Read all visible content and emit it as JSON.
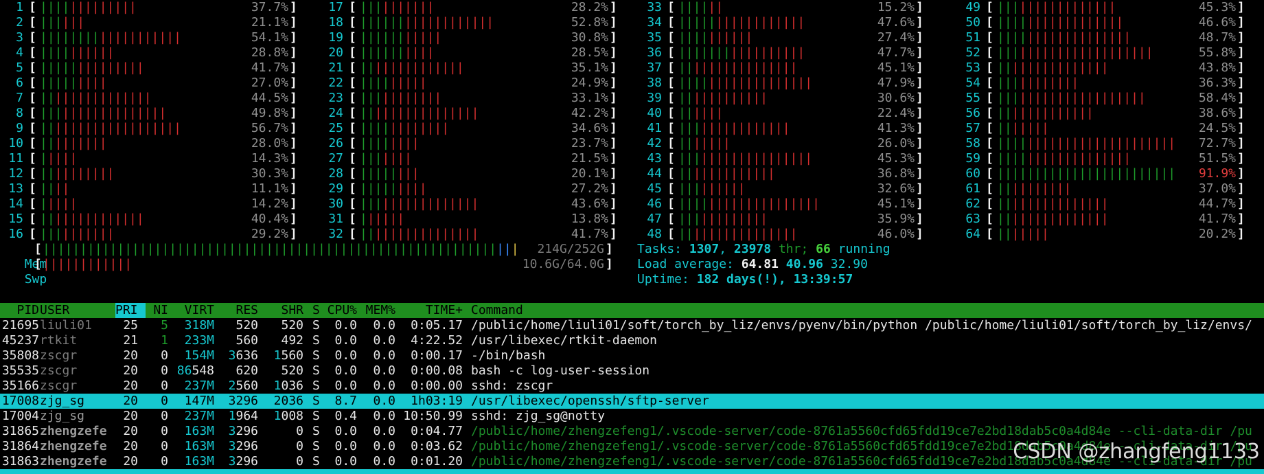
{
  "cpus": [
    {
      "n": "1",
      "g": 4,
      "r": 9,
      "pct": "37.7%"
    },
    {
      "n": "2",
      "g": 3,
      "r": 3,
      "pct": "21.1%"
    },
    {
      "n": "3",
      "g": 8,
      "r": 11,
      "pct": "54.1%"
    },
    {
      "n": "4",
      "g": 4,
      "r": 6,
      "pct": "28.8%"
    },
    {
      "n": "5",
      "g": 5,
      "r": 9,
      "pct": "41.7%"
    },
    {
      "n": "6",
      "g": 5,
      "r": 4,
      "pct": "27.0%"
    },
    {
      "n": "7",
      "g": 2,
      "r": 13,
      "pct": "44.5%"
    },
    {
      "n": "8",
      "g": 3,
      "r": 14,
      "pct": "49.8%"
    },
    {
      "n": "9",
      "g": 2,
      "r": 17,
      "pct": "56.7%"
    },
    {
      "n": "10",
      "g": 2,
      "r": 7,
      "pct": "28.0%"
    },
    {
      "n": "11",
      "g": 1,
      "r": 4,
      "pct": "14.3%"
    },
    {
      "n": "12",
      "g": 2,
      "r": 8,
      "pct": "30.3%"
    },
    {
      "n": "13",
      "g": 2,
      "r": 2,
      "pct": "11.1%"
    },
    {
      "n": "14",
      "g": 1,
      "r": 4,
      "pct": "14.2%"
    },
    {
      "n": "15",
      "g": 2,
      "r": 12,
      "pct": "40.4%"
    },
    {
      "n": "16",
      "g": 3,
      "r": 7,
      "pct": "29.2%"
    },
    {
      "n": "17",
      "g": 3,
      "r": 7,
      "pct": "28.2%"
    },
    {
      "n": "18",
      "g": 6,
      "r": 12,
      "pct": "52.8%"
    },
    {
      "n": "19",
      "g": 6,
      "r": 5,
      "pct": "30.8%"
    },
    {
      "n": "20",
      "g": 6,
      "r": 4,
      "pct": "28.5%"
    },
    {
      "n": "21",
      "g": 2,
      "r": 12,
      "pct": "35.1%"
    },
    {
      "n": "22",
      "g": 4,
      "r": 5,
      "pct": "24.9%"
    },
    {
      "n": "23",
      "g": 3,
      "r": 8,
      "pct": "33.1%"
    },
    {
      "n": "24",
      "g": 2,
      "r": 14,
      "pct": "42.2%"
    },
    {
      "n": "25",
      "g": 4,
      "r": 8,
      "pct": "34.6%"
    },
    {
      "n": "26",
      "g": 4,
      "r": 4,
      "pct": "23.7%"
    },
    {
      "n": "27",
      "g": 3,
      "r": 4,
      "pct": "21.5%"
    },
    {
      "n": "28",
      "g": 5,
      "r": 3,
      "pct": "20.1%"
    },
    {
      "n": "29",
      "g": 5,
      "r": 4,
      "pct": "27.2%"
    },
    {
      "n": "30",
      "g": 3,
      "r": 13,
      "pct": "43.6%"
    },
    {
      "n": "31",
      "g": 1,
      "r": 5,
      "pct": "13.8%"
    },
    {
      "n": "32",
      "g": 2,
      "r": 14,
      "pct": "41.7%"
    },
    {
      "n": "33",
      "g": 4,
      "r": 2,
      "pct": "15.2%"
    },
    {
      "n": "34",
      "g": 5,
      "r": 12,
      "pct": "47.6%"
    },
    {
      "n": "35",
      "g": 4,
      "r": 6,
      "pct": "27.4%"
    },
    {
      "n": "36",
      "g": 7,
      "r": 10,
      "pct": "47.7%"
    },
    {
      "n": "37",
      "g": 2,
      "r": 14,
      "pct": "45.1%"
    },
    {
      "n": "38",
      "g": 4,
      "r": 14,
      "pct": "47.9%"
    },
    {
      "n": "39",
      "g": 2,
      "r": 10,
      "pct": "30.6%"
    },
    {
      "n": "40",
      "g": 2,
      "r": 4,
      "pct": "22.4%"
    },
    {
      "n": "41",
      "g": 3,
      "r": 12,
      "pct": "41.3%"
    },
    {
      "n": "42",
      "g": 2,
      "r": 5,
      "pct": "26.0%"
    },
    {
      "n": "43",
      "g": 3,
      "r": 15,
      "pct": "45.3%"
    },
    {
      "n": "44",
      "g": 2,
      "r": 11,
      "pct": "36.8%"
    },
    {
      "n": "45",
      "g": 3,
      "r": 6,
      "pct": "32.6%"
    },
    {
      "n": "46",
      "g": 4,
      "r": 15,
      "pct": "45.1%"
    },
    {
      "n": "47",
      "g": 3,
      "r": 9,
      "pct": "35.9%"
    },
    {
      "n": "48",
      "g": 2,
      "r": 14,
      "pct": "46.0%"
    },
    {
      "n": "49",
      "g": 3,
      "r": 13,
      "pct": "45.3%"
    },
    {
      "n": "50",
      "g": 4,
      "r": 13,
      "pct": "46.6%"
    },
    {
      "n": "51",
      "g": 4,
      "r": 14,
      "pct": "48.7%"
    },
    {
      "n": "52",
      "g": 3,
      "r": 18,
      "pct": "55.8%"
    },
    {
      "n": "53",
      "g": 2,
      "r": 13,
      "pct": "43.8%"
    },
    {
      "n": "54",
      "g": 3,
      "r": 8,
      "pct": "36.3%"
    },
    {
      "n": "55",
      "g": 3,
      "r": 17,
      "pct": "58.4%"
    },
    {
      "n": "56",
      "g": 2,
      "r": 11,
      "pct": "38.6%"
    },
    {
      "n": "57",
      "g": 2,
      "r": 5,
      "pct": "24.5%"
    },
    {
      "n": "58",
      "g": 4,
      "r": 21,
      "pct": "72.7%"
    },
    {
      "n": "59",
      "g": 4,
      "r": 14,
      "pct": "51.5%"
    },
    {
      "n": "60",
      "g": 30,
      "r": 0,
      "pct": "91.9%",
      "hot": true
    },
    {
      "n": "61",
      "g": 2,
      "r": 8,
      "pct": "37.0%"
    },
    {
      "n": "62",
      "g": 2,
      "r": 13,
      "pct": "44.7%"
    },
    {
      "n": "63",
      "g": 2,
      "r": 13,
      "pct": "41.7%"
    },
    {
      "n": "64",
      "g": 2,
      "r": 5,
      "pct": "20.2%"
    }
  ],
  "mem": {
    "label": "Mem",
    "used_fraction": 0.85,
    "value": "214G/252G"
  },
  "swp": {
    "label": "Swp",
    "used_fraction": 0.17,
    "value": "10.6G/64.0G"
  },
  "tasks": {
    "label": "Tasks:",
    "count": "1307",
    "sep": ",",
    "thr": "23978",
    "thr_label": "thr;",
    "running": "66",
    "running_label": "running"
  },
  "load": {
    "label": "Load average:",
    "l1": "64.81",
    "l5": "40.96",
    "l15": "32.90"
  },
  "uptime": {
    "label": "Uptime:",
    "value": "182 days(!), 13:39:57"
  },
  "columns": [
    "PID",
    "USER",
    "PRI",
    "NI",
    "VIRT",
    "RES",
    "SHR",
    "S",
    "CPU%",
    "MEM%",
    "TIME+",
    "Command"
  ],
  "processes": [
    {
      "pid": "21695",
      "user": "liuli01",
      "pri": "25",
      "ni": "5",
      "virt": "318M",
      "res": "520",
      "shr": "520",
      "s": "S",
      "cpu": "0.0",
      "mem": "0.0",
      "time": "0:05.17",
      "cmd": "/public/home/liuli01/soft/torch_by_liz/envs/pyenv/bin/python /public/home/liuli01/soft/torch_by_liz/envs/"
    },
    {
      "pid": "45237",
      "user": "rtkit",
      "pri": "21",
      "ni": "1",
      "virt": "233M",
      "res": "560",
      "shr": "492",
      "s": "S",
      "cpu": "0.0",
      "mem": "0.0",
      "time": "4:22.52",
      "cmd": "/usr/libexec/rtkit-daemon"
    },
    {
      "pid": "35808",
      "user": "zscgr",
      "pri": "20",
      "ni": "0",
      "virt": "154M",
      "res": "3636",
      "shr": "1560",
      "s": "S",
      "cpu": "0.0",
      "mem": "0.0",
      "time": "0:00.17",
      "cmd": "-/bin/bash"
    },
    {
      "pid": "35535",
      "user": "zscgr",
      "pri": "20",
      "ni": "0",
      "virt": "86548",
      "res": "620",
      "shr": "520",
      "s": "S",
      "cpu": "0.0",
      "mem": "0.0",
      "time": "0:00.08",
      "cmd": "bash -c log-user-session"
    },
    {
      "pid": "35166",
      "user": "zscgr",
      "pri": "20",
      "ni": "0",
      "virt": "237M",
      "res": "2560",
      "shr": "1036",
      "s": "S",
      "cpu": "0.0",
      "mem": "0.0",
      "time": "0:00.00",
      "cmd": "sshd: zscgr"
    },
    {
      "pid": "17008",
      "user": "zjg_sg",
      "pri": "20",
      "ni": "0",
      "virt": "147M",
      "res": "3296",
      "shr": "2036",
      "s": "S",
      "cpu": "8.7",
      "mem": "0.0",
      "time": "1h03:19",
      "cmd": "/usr/libexec/openssh/sftp-server",
      "selected": true
    },
    {
      "pid": "17004",
      "user": "zjg_sg",
      "pri": "20",
      "ni": "0",
      "virt": "237M",
      "res": "1964",
      "shr": "1008",
      "s": "S",
      "cpu": "0.4",
      "mem": "0.0",
      "time": "10:50.99",
      "cmd": "sshd: zjg_sg@notty"
    },
    {
      "pid": "31865",
      "user": "zhengzefe",
      "pri": "20",
      "ni": "0",
      "virt": "163M",
      "res": "3296",
      "shr": "0",
      "s": "S",
      "cpu": "0.0",
      "mem": "0.0",
      "time": "0:04.77",
      "cmd": "/public/home/zhengzefeng1/.vscode-server/code-8761a5560cfd65fdd19ce7e2bd18dab5c0a4d84e --cli-data-dir /pu"
    },
    {
      "pid": "31864",
      "user": "zhengzefe",
      "pri": "20",
      "ni": "0",
      "virt": "163M",
      "res": "3296",
      "shr": "0",
      "s": "S",
      "cpu": "0.0",
      "mem": "0.0",
      "time": "0:03.62",
      "cmd": "/public/home/zhengzefeng1/.vscode-server/code-8761a5560cfd65fdd19ce7e2bd18dab5c0a4d84e --cli-data-dir /pu"
    },
    {
      "pid": "31863",
      "user": "zhengzefe",
      "pri": "20",
      "ni": "0",
      "virt": "163M",
      "res": "3296",
      "shr": "0",
      "s": "S",
      "cpu": "0.0",
      "mem": "0.0",
      "time": "0:01.20",
      "cmd": "/public/home/zhengzefeng1/.vscode-server/code-8761a5560cfd65fdd19ce7e2bd18dab5c0a4d84e --cli-data-dir /pu"
    }
  ],
  "watermark": "CSDN @zhangfeng1133",
  "colors": {
    "cyan": "#16c8d0",
    "header_green": "#1f8e1f",
    "bar_green": "#1e9c2b",
    "bar_red": "#d62f2f"
  }
}
